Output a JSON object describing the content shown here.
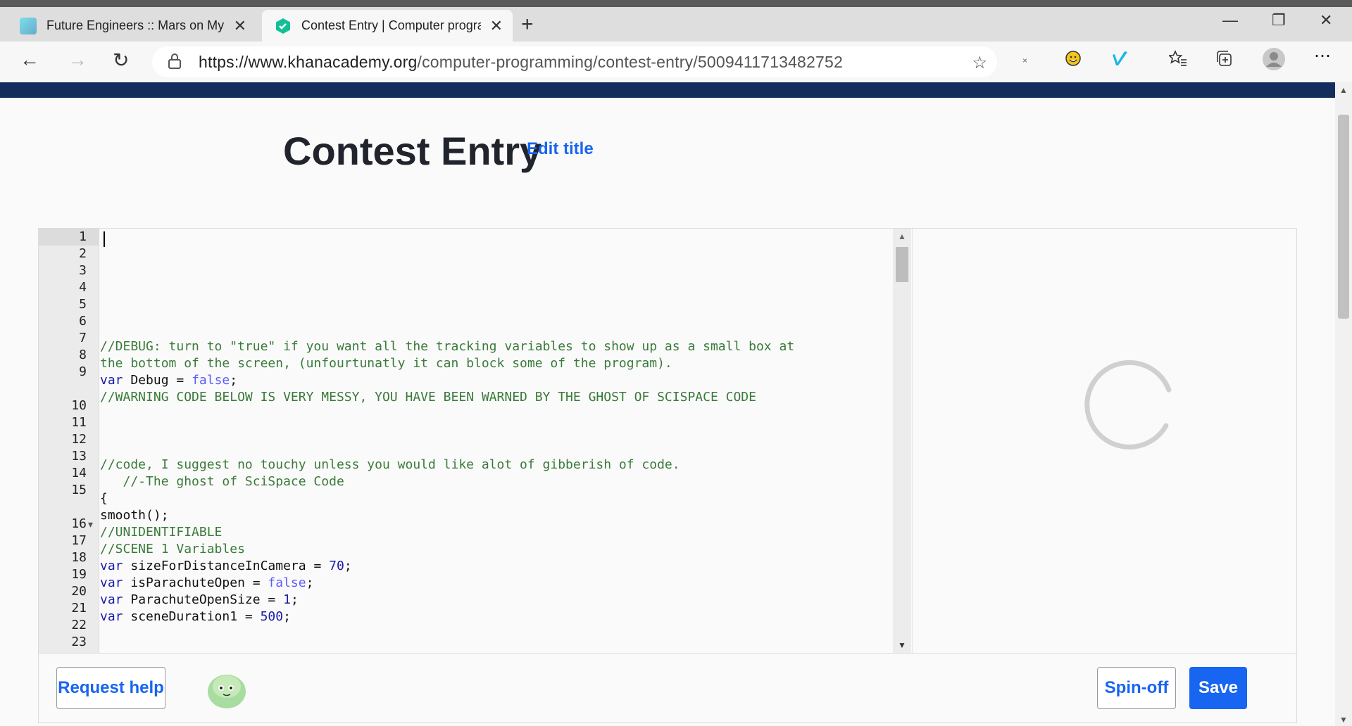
{
  "browser": {
    "tabs": [
      {
        "title": "Future Engineers :: Mars on My N"
      },
      {
        "title": "Contest Entry | Computer progra"
      }
    ],
    "url_domain": "https://www.khanacademy.org",
    "url_path": "/computer-programming/contest-entry/5009411713482752"
  },
  "page": {
    "title": "Contest Entry",
    "edit_title_link": "Edit title"
  },
  "editor": {
    "line_numbers": [
      "1",
      "2",
      "3",
      "4",
      "5",
      "6",
      "7",
      "8",
      "9",
      "",
      "10",
      "11",
      "12",
      "13",
      "14",
      "15",
      "",
      "16",
      "17",
      "18",
      "19",
      "20",
      "21",
      "22",
      "23"
    ],
    "fold_marker_line": "16",
    "code": {
      "l9a": "//DEBUG: turn to \"true\" if you want all the tracking variables to show up as a small box at",
      "l9b": "the bottom of the screen, (unfourtunatly it can block some of the program).",
      "l10_kw": "var",
      "l10_name": " Debug = ",
      "l10_val": "false",
      "l10_end": ";",
      "l11": "//WARNING CODE BELOW IS VERY MESSY, YOU HAVE BEEN WARNED BY THE GHOST OF SCISPACE CODE",
      "l15a": "//code, I suggest no touchy unless you would like alot of gibberish of code.",
      "l15b": "   //-The ghost of SciSpace Code",
      "l16": "{",
      "l17": "smooth();",
      "l18": "//UNIDENTIFIABLE",
      "l19": "//SCENE 1 Variables",
      "l20_kw": "var",
      "l20_name": " sizeForDistanceInCamera = ",
      "l20_val": "70",
      "l20_end": ";",
      "l21_kw": "var",
      "l21_name": " isParachuteOpen = ",
      "l21_val": "false",
      "l21_end": ";",
      "l22_kw": "var",
      "l22_name": " ParachuteOpenSize = ",
      "l22_val": "1",
      "l22_end": ";",
      "l23_kw": "var",
      "l23_name": " sceneDuration1 = ",
      "l23_val": "500",
      "l23_end": ";"
    }
  },
  "footer": {
    "request_help": "Request help",
    "spin_off": "Spin-off",
    "save": "Save"
  },
  "colors": {
    "accent": "#1865f2",
    "nav_band": "#142d5c",
    "comment": "#3a7a3a",
    "keyword": "#1a1aa6"
  }
}
